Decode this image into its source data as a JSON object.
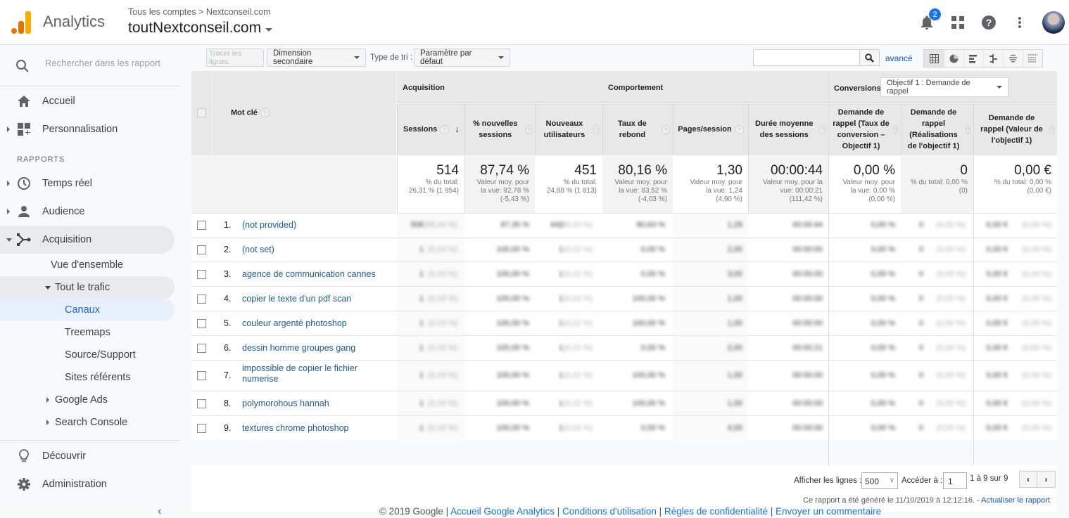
{
  "header": {
    "app_name": "Analytics",
    "breadcrumb": "Tous les comptes > Nextconseil.com",
    "account": "toutNextconseil.com",
    "notifications_count": "2",
    "icons": [
      "notifications-icon",
      "apps-grid-icon",
      "help-icon",
      "more-vert-icon",
      "avatar"
    ],
    "logo_colors": [
      "#e37400",
      "#f9ab00"
    ]
  },
  "sidebar": {
    "search_placeholder": "Rechercher dans les rapport",
    "items": [
      {
        "label": "Accueil",
        "icon": "home-icon"
      },
      {
        "label": "Personnalisation",
        "icon": "dashboard-customize-icon"
      }
    ],
    "section_label": "RAPPORTS",
    "reports": [
      {
        "label": "Temps réel",
        "icon": "clock-icon"
      },
      {
        "label": "Audience",
        "icon": "person-icon"
      },
      {
        "label": "Acquisition",
        "icon": "acquisition-icon",
        "expanded": true
      }
    ],
    "acquisition_children": {
      "overview": "Vue d'ensemble",
      "all_traffic": "Tout le trafic",
      "all_traffic_items": [
        "Canaux",
        "Treemaps",
        "Source/Support",
        "Sites référents"
      ],
      "google_ads": "Google Ads",
      "search_console": "Search Console"
    },
    "bottom": [
      {
        "label": "Découvrir",
        "icon": "lightbulb-icon"
      },
      {
        "label": "Administration",
        "icon": "gear-icon"
      }
    ],
    "active_item": "Canaux"
  },
  "toolbar": {
    "plot_rows": "Tracer les lignes",
    "secondary_dimension": "Dimension secondaire",
    "sort_type_label": "Type de tri :",
    "sort_type_value": "Paramètre par défaut",
    "search_value": "",
    "advanced": "avancé"
  },
  "table": {
    "group_headers": {
      "acquisition": "Acquisition",
      "behavior": "Comportement",
      "conversions": "Conversions",
      "goal_select": "Objectif 1 : Demande de rappel"
    },
    "dimension_header": "Mot clé",
    "columns": [
      "Sessions",
      "% nouvelles sessions",
      "Nouveaux utilisateurs",
      "Taux de rebond",
      "Pages/session",
      "Durée moyenne des sessions",
      "Demande de rappel (Taux de conversion – Objectif 1)",
      "Demande de rappel (Réalisations de l'objectif 1)",
      "Demande de rappel (Valeur de l'objectif 1)"
    ],
    "totals": [
      {
        "value": "514",
        "sub1": "% du total:",
        "sub2": "26,31 % (1 954)",
        "sub3": ""
      },
      {
        "value": "87,74 %",
        "sub1": "Valeur moy. pour",
        "sub2": "la vue: 92,78 %",
        "sub3": "(-5,43 %)"
      },
      {
        "value": "451",
        "sub1": "% du total:",
        "sub2": "24,88 % (1 813)",
        "sub3": ""
      },
      {
        "value": "80,16 %",
        "sub1": "Valeur moy. pour",
        "sub2": "la vue: 83,52 %",
        "sub3": "(-4,03 %)"
      },
      {
        "value": "1,30",
        "sub1": "Valeur moy. pour",
        "sub2": "la vue: 1,24",
        "sub3": "(4,90 %)"
      },
      {
        "value": "00:00:44",
        "sub1": "Valeur moy. pour la",
        "sub2": "vue: 00:00:21",
        "sub3": "(111,42 %)"
      },
      {
        "value": "0,00 %",
        "sub1": "Valeur moy. pour",
        "sub2": "la vue: 0,00 %",
        "sub3": "(0,00 %)"
      },
      {
        "value": "0",
        "sub1": "% du total: 0,00 %",
        "sub2": "(0)",
        "sub3": ""
      },
      {
        "value": "0,00 €",
        "sub1": "% du total: 0,00 %",
        "sub2": "(0,00 €)",
        "sub3": ""
      }
    ],
    "rows": [
      {
        "num": "1.",
        "keyword": "(not provided)",
        "cells": [
          "506",
          "(98,44 %)",
          "87,35 %",
          "443",
          "(98,23 %)",
          "80,63 %",
          "1,29",
          "00:00:44",
          "0,00 %",
          "0",
          "(0,00 %)",
          "0,00 €",
          "(0,00 %)"
        ]
      },
      {
        "num": "2.",
        "keyword": "(not set)",
        "cells": [
          "1",
          "(0,19 %)",
          "100,00 %",
          "1",
          "(0,22 %)",
          "0,00 %",
          "2,00",
          "00:00:00",
          "0,00 %",
          "0",
          "(0,00 %)",
          "0,00 €",
          "(0,00 %)"
        ]
      },
      {
        "num": "3.",
        "keyword": "agence de communication cannes",
        "cells": [
          "1",
          "(0,19 %)",
          "100,00 %",
          "1",
          "(0,22 %)",
          "0,00 %",
          "3,00",
          "00:00:00",
          "0,00 %",
          "0",
          "(0,00 %)",
          "0,00 €",
          "(0,00 %)"
        ]
      },
      {
        "num": "4.",
        "keyword": "copier le texte d'un pdf scan",
        "cells": [
          "1",
          "(0,19 %)",
          "100,00 %",
          "1",
          "(0,22 %)",
          "100,00 %",
          "1,00",
          "00:00:00",
          "0,00 %",
          "0",
          "(0,00 %)",
          "0,00 €",
          "(0,00 %)"
        ]
      },
      {
        "num": "5.",
        "keyword": "couleur argenté photoshop",
        "cells": [
          "1",
          "(0,19 %)",
          "100,00 %",
          "1",
          "(0,22 %)",
          "100,00 %",
          "1,00",
          "00:00:00",
          "0,00 %",
          "0",
          "(0,00 %)",
          "0,00 €",
          "(0,00 %)"
        ]
      },
      {
        "num": "6.",
        "keyword": "dessin homme groupes gang",
        "cells": [
          "1",
          "(0,19 %)",
          "100,00 %",
          "1",
          "(0,22 %)",
          "0,00 %",
          "2,00",
          "00:00:21",
          "0,00 %",
          "0",
          "(0,00 %)",
          "0,00 €",
          "(0,00 %)"
        ]
      },
      {
        "num": "7.",
        "keyword": "impossible de copier le fichier numerise",
        "cells": [
          "1",
          "(0,19 %)",
          "100,00 %",
          "1",
          "(0,22 %)",
          "100,00 %",
          "1,00",
          "00:00:00",
          "0,00 %",
          "0",
          "(0,00 %)",
          "0,00 €",
          "(0,00 %)"
        ]
      },
      {
        "num": "8.",
        "keyword": "polymorohous hannah",
        "cells": [
          "1",
          "(0,19 %)",
          "100,00 %",
          "1",
          "(0,22 %)",
          "100,00 %",
          "1,00",
          "00:00:00",
          "0,00 %",
          "0",
          "(0,00 %)",
          "0,00 €",
          "(0,00 %)"
        ]
      },
      {
        "num": "9.",
        "keyword": "textures chrome photoshop",
        "cells": [
          "1",
          "(0,19 %)",
          "100,00 %",
          "1",
          "(0,22 %)",
          "0,00 %",
          "4,00",
          "00:00:00",
          "0,00 %",
          "0",
          "(0,00 %)",
          "0,00 €",
          "(0,00 %)"
        ]
      }
    ]
  },
  "pagination": {
    "rows_label": "Afficher les lignes :",
    "rows_value": "500",
    "goto_label": "Accéder à :",
    "goto_value": "1",
    "range": "1 à 9 sur 9",
    "prev": "‹",
    "next": "›"
  },
  "report_generated": "Ce rapport a été généré le 11/10/2019 à 12:12:16. -",
  "refresh_link": "Actualiser le rapport",
  "footer": {
    "copyright": "© 2019 Google",
    "links": [
      "Accueil Google Analytics",
      "Conditions d'utilisation",
      "Règles de confidentialité",
      "Envoyer un commentaire"
    ]
  }
}
